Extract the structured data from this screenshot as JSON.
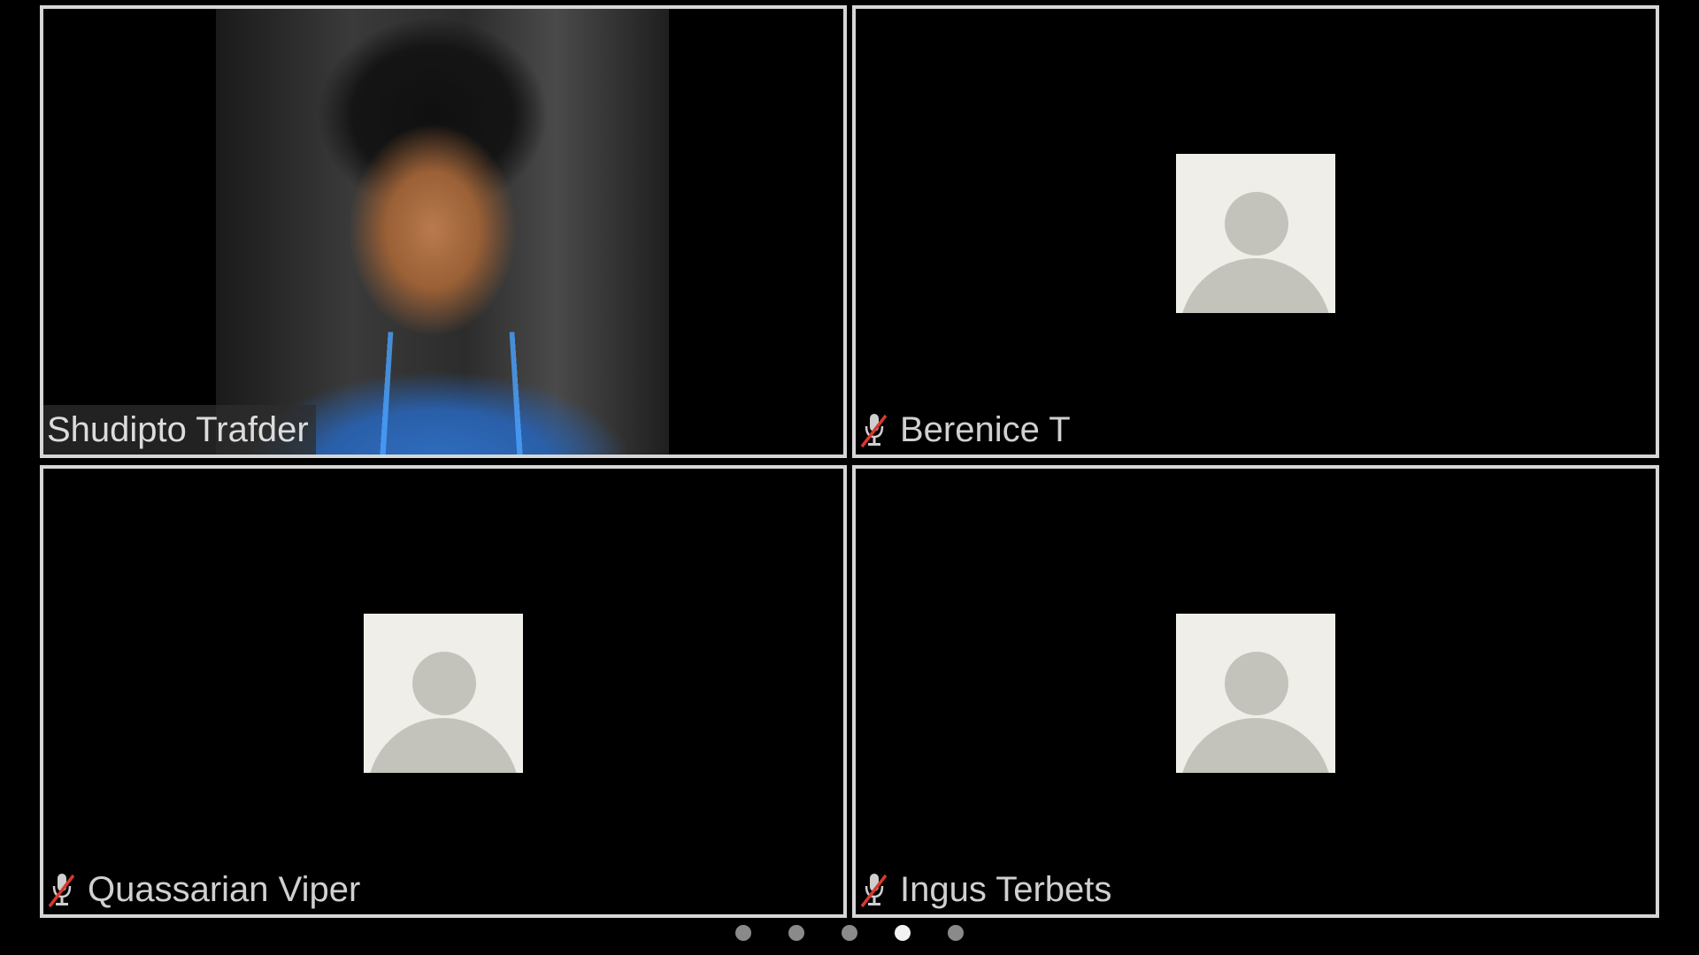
{
  "participants": [
    {
      "name": "Shudipto Trafder",
      "muted": false,
      "has_video": true
    },
    {
      "name": "Berenice T",
      "muted": true,
      "has_video": false
    },
    {
      "name": "Quassarian Viper",
      "muted": true,
      "has_video": false
    },
    {
      "name": "Ingus Terbets",
      "muted": true,
      "has_video": false
    }
  ],
  "pager": {
    "page_count": 5,
    "active_page": 4
  },
  "icons": {
    "mute": "mic-off-icon",
    "avatar": "default-avatar-icon"
  },
  "colors": {
    "background": "#000000",
    "tile_border": "#d6d6d6",
    "name_text": "#d0d0d0",
    "mute_slash": "#d9382c",
    "avatar_bg": "#efeee9",
    "avatar_fg": "#c4c3bb",
    "dot_inactive": "#8a8a8a",
    "dot_active": "#f2f2f2"
  }
}
